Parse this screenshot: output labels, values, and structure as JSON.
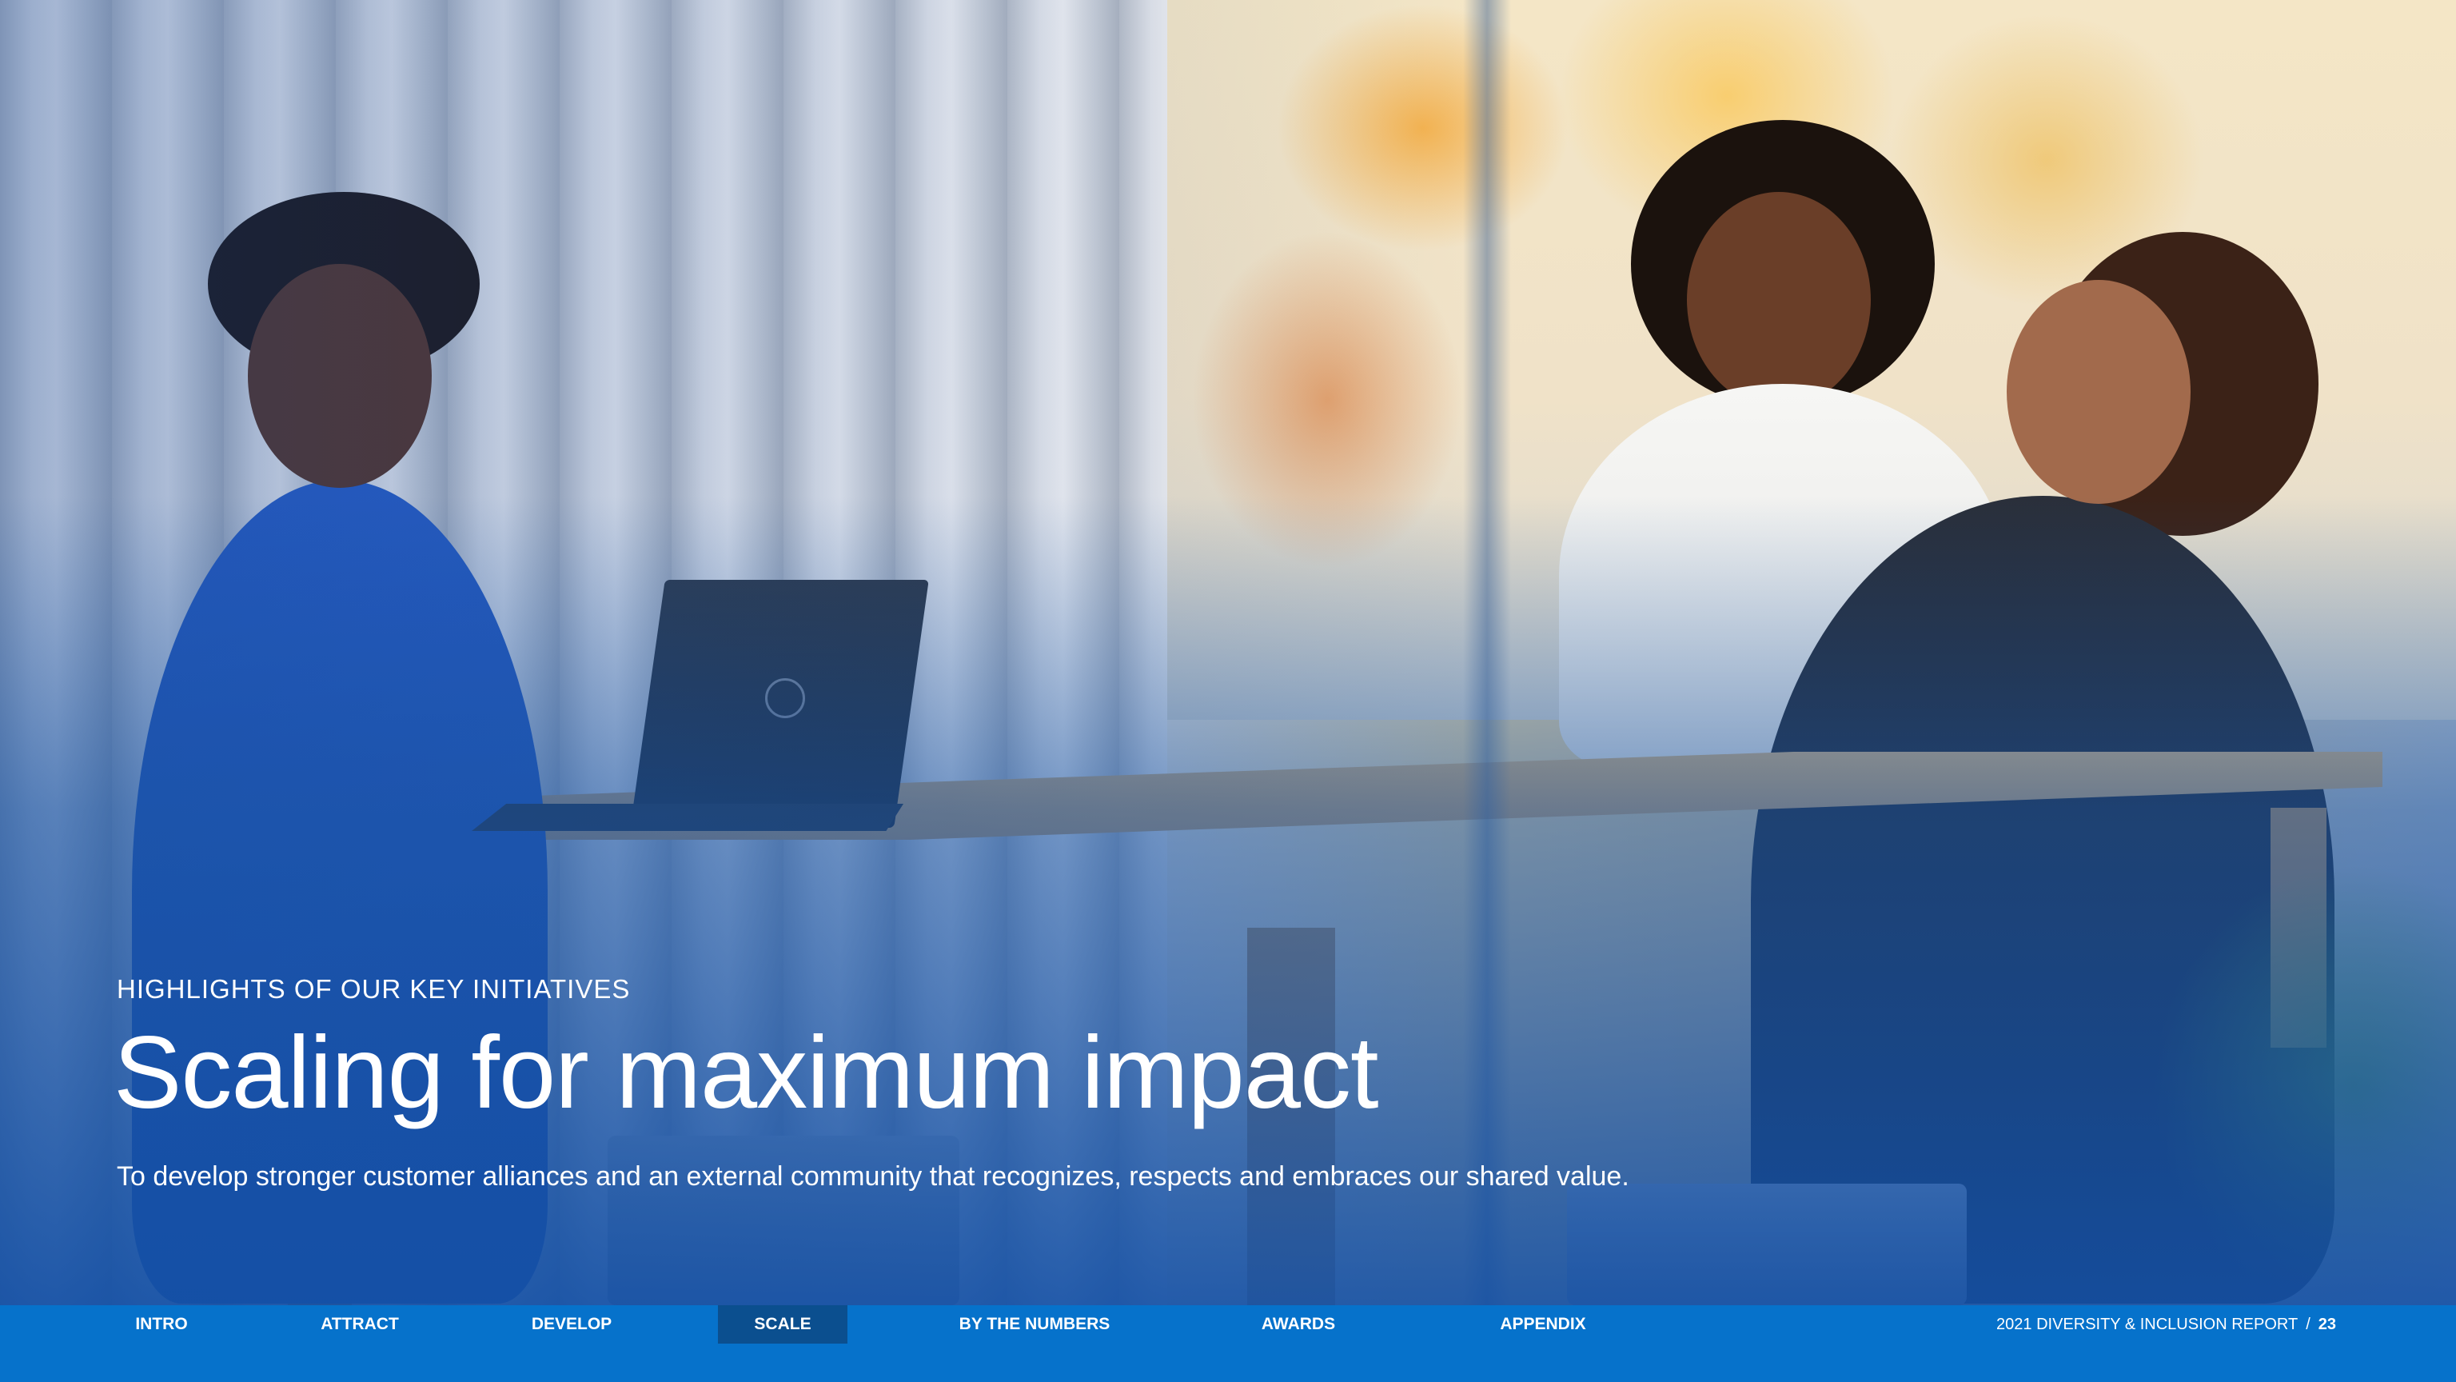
{
  "hero": {
    "eyebrow": "HIGHLIGHTS OF OUR KEY INITIATIVES",
    "title": "Scaling for maximum impact",
    "subtitle": "To develop stronger customer alliances and an external community that recognizes, respects and embraces our shared value."
  },
  "nav": {
    "items": [
      {
        "label": "INTRO",
        "active": false
      },
      {
        "label": "ATTRACT",
        "active": false
      },
      {
        "label": "DEVELOP",
        "active": false
      },
      {
        "label": "SCALE",
        "active": true
      },
      {
        "label": "BY THE NUMBERS",
        "active": false
      },
      {
        "label": "AWARDS",
        "active": false
      },
      {
        "label": "APPENDIX",
        "active": false
      }
    ]
  },
  "footer": {
    "report_title": "2021 DIVERSITY & INCLUSION REPORT",
    "separator": "/",
    "page_number": "23"
  },
  "colors": {
    "nav_background": "#0672cb",
    "nav_active": "#0b4f8f",
    "text": "#ffffff"
  }
}
